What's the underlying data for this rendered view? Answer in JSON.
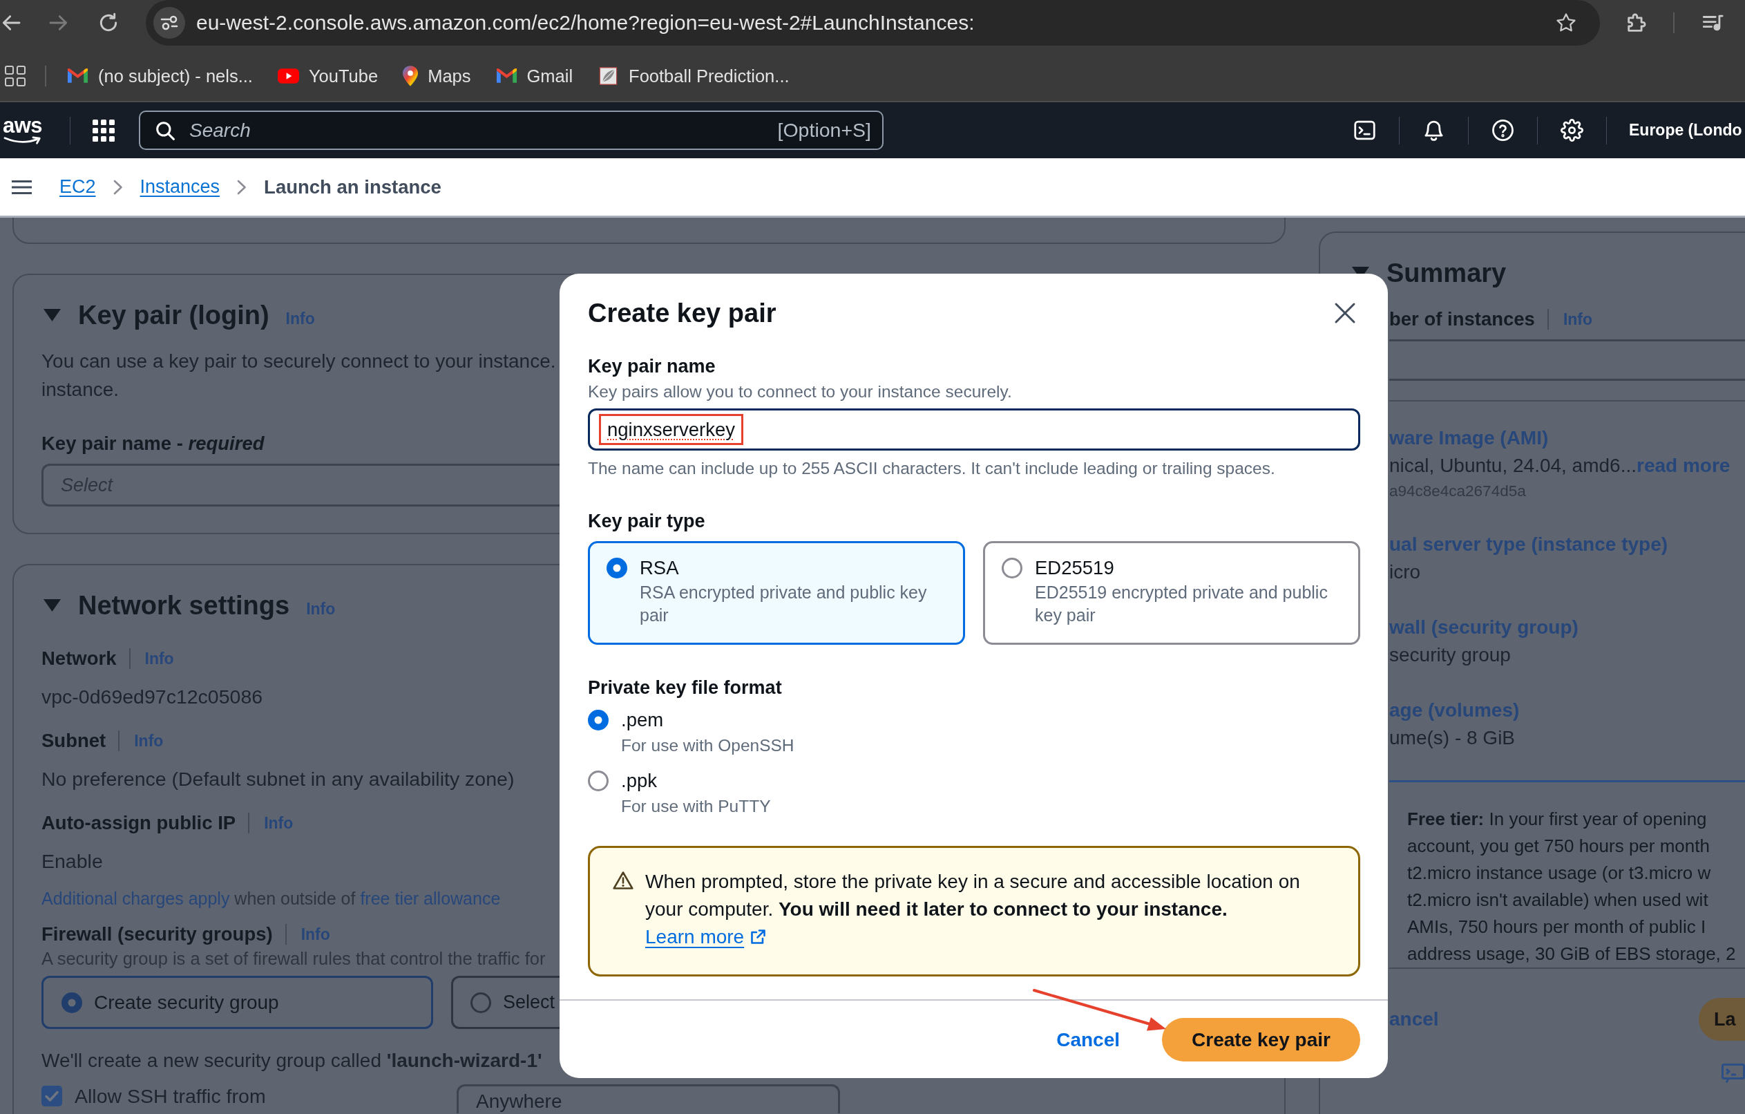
{
  "browser": {
    "url": "eu-west-2.console.aws.amazon.com/ec2/home?region=eu-west-2#LaunchInstances:",
    "bookmarks": [
      {
        "kind": "mail",
        "label": "(no subject) - nels..."
      },
      {
        "kind": "video",
        "label": "YouTube"
      },
      {
        "kind": "map",
        "label": "Maps"
      },
      {
        "kind": "mail",
        "label": "Gmail"
      },
      {
        "kind": "page",
        "label": "Football Prediction..."
      }
    ]
  },
  "console_nav": {
    "logo": "aws",
    "search": {
      "placeholder": "Search",
      "shortcut": "[Option+S]"
    },
    "region": "Europe (Londo"
  },
  "breadcrumbs": [
    {
      "label": "EC2",
      "current": false
    },
    {
      "label": "Instances",
      "current": false
    },
    {
      "label": "Launch an instance",
      "current": true
    }
  ],
  "key_pair_section": {
    "title": "Key pair (login)",
    "info": "Info",
    "description_lines": [
      "You can use a key pair to securely connect to your instance.",
      "instance."
    ],
    "field_label": "Key pair name - *required*",
    "select": {
      "placeholder": "Select"
    }
  },
  "network_section": {
    "title": "Network settings",
    "info": "Info",
    "fields": [
      {
        "label": "Network",
        "info": "Info",
        "value": "vpc-0d69ed97c12c05086"
      },
      {
        "label": "Subnet",
        "info": "Info",
        "value": "No preference (Default subnet in any availability zone)"
      },
      {
        "label": "Auto-assign public IP",
        "info": "Info",
        "value": "Enable"
      }
    ],
    "charges_note": {
      "link": "Additional charges apply",
      "text": "when outside of",
      "link_2": "free tier allowance"
    },
    "firewall": {
      "label": "Firewall (security groups)",
      "info": "Info",
      "description": "A security group is a set of firewall rules that control the traffic for",
      "options": [
        {
          "label": "Create security group",
          "selected": true
        },
        {
          "label": "Select",
          "selected": false
        }
      ],
      "note": "We'll create a new security group called **'launch-wizard-1'**"
    },
    "ssh_rule": {
      "label": "Allow SSH traffic from",
      "checked": true,
      "source": "Anywhere"
    }
  },
  "summary": {
    "title": "Summary",
    "instances_label": "ber of instances",
    "info": "Info",
    "items": [
      {
        "heading": "ware Image (AMI)",
        "value": "nical, Ubuntu, 24.04, amd6...",
        "link": "read more",
        "detail": "a94c8e4ca2674d5a"
      },
      {
        "heading": "ual server type (instance type)",
        "value": "icro"
      },
      {
        "heading": "wall (security group)",
        "value": "security group"
      },
      {
        "heading": "age (volumes)",
        "value": "ume(s) - 8 GiB"
      }
    ],
    "free_tier_lines": [
      "**Free tier:** In your first year of opening",
      "account, you get 750 hours per month",
      "t2.micro instance usage (or t3.micro w",
      "t2.micro isn't available) when used wit",
      "AMIs, 750 hours per month of public I",
      "address usage, 30 GiB of EBS storage, 2"
    ],
    "cancel": "ancel",
    "launch": "La"
  },
  "modal": {
    "title": "Create key pair",
    "name_label": "Key pair name",
    "name_description": "Key pairs allow you to connect to your instance securely.",
    "name_value": "nginxserverkey",
    "name_spelling_flag": true,
    "name_hint": "The name can include up to 255 ASCII characters. It can't include leading or trailing spaces.",
    "type_label": "Key pair type",
    "types": [
      {
        "label": "RSA",
        "description": "RSA encrypted private and public key pair",
        "selected": true
      },
      {
        "label": "ED25519",
        "description": "ED25519 encrypted private and public key pair",
        "selected": false
      }
    ],
    "format_label": "Private key file format",
    "formats": [
      {
        "label": ".pem",
        "description": "For use with OpenSSH",
        "selected": true
      },
      {
        "label": ".ppk",
        "description": "For use with PuTTY",
        "selected": false
      }
    ],
    "alert": {
      "text": "When prompted, store the private key in a secure and accessible location on your computer. **You will need it later to connect to your instance.**",
      "link": "Learn more"
    },
    "cancel": "Cancel",
    "confirm": "Create key pair",
    "annotations": {
      "name_box": true,
      "arrow": true
    }
  }
}
